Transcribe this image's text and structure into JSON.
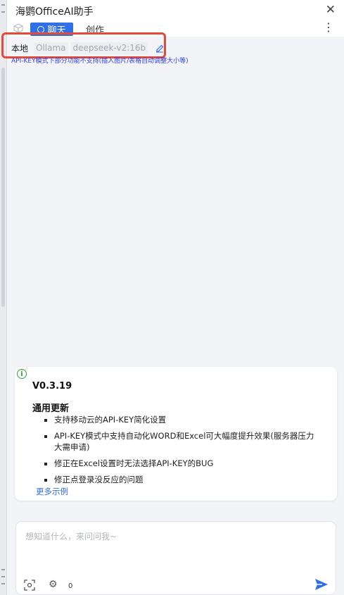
{
  "window": {
    "title": "海鹦OfficeAI助手"
  },
  "tabs": [
    {
      "label": "聊天",
      "active": true
    },
    {
      "label": "创作",
      "active": false
    }
  ],
  "model": {
    "mode": "本地",
    "provider": "Ollama",
    "name": "deepseek-v2:16b",
    "hint": "API-KEY模式下部分功能不支持(插入图片/表格自动调整大小等)"
  },
  "release_card": {
    "version": "V0.3.19",
    "section_title": "通用更新",
    "items": [
      "支持移动云的API-KEY简化设置",
      "API-KEY模式中支持自动化WORD和Excel可大幅度提升效果(服务器压力大需申请)",
      "修正在Excel设置时无法选择API-KEY的BUG",
      "修正点登录没反应的问题"
    ],
    "more_link": "更多示例"
  },
  "composer": {
    "placeholder": "想知道什么，来问问我~",
    "value": "",
    "count": "0"
  },
  "colors": {
    "accent": "#2f6fe8",
    "highlight_border": "#e54937",
    "info_green": "#3c9b3c"
  },
  "icons": [
    "close-icon",
    "cube-icon",
    "chat-icon",
    "more-vertical-icon",
    "edit-pencil-icon",
    "info-icon",
    "scan-icon",
    "gear-icon",
    "send-icon"
  ]
}
